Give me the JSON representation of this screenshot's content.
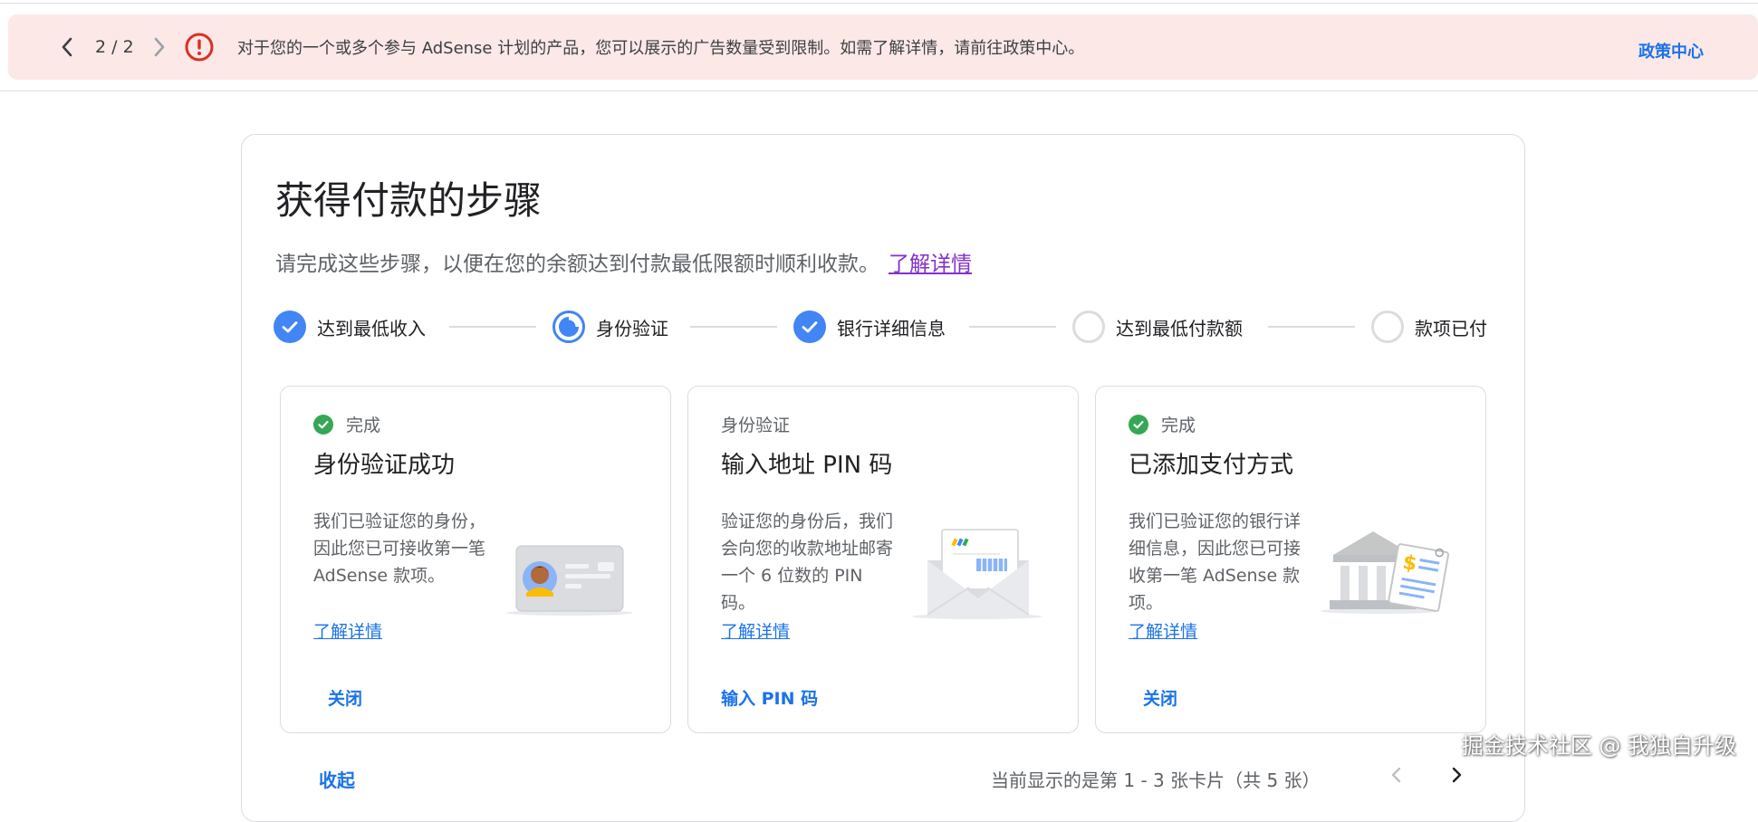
{
  "alert": {
    "pager": "2 / 2",
    "message": "对于您的一个或多个参与 AdSense 计划的产品，您可以展示的广告数量受到限制。如需了解详情，请前往政策中心。",
    "policy_link": "政策中心",
    "color": "#d93025",
    "background": "#fce8e6"
  },
  "main": {
    "title": "获得付款的步骤",
    "subtitle": "请完成这些步骤，以便在您的余额达到付款最低限额时顺利收款。",
    "learn_more": "了解详情"
  },
  "steps": [
    {
      "label": "达到最低收入",
      "state": "done"
    },
    {
      "label": "身份验证",
      "state": "in-progress"
    },
    {
      "label": "银行详细信息",
      "state": "done"
    },
    {
      "label": "达到最低付款额",
      "state": "todo"
    },
    {
      "label": "款项已付",
      "state": "todo"
    }
  ],
  "cards": [
    {
      "status": "完成",
      "title": "身份验证成功",
      "body": "我们已验证您的身份，因此您已可接收第一笔 AdSense 款项。",
      "learn_more": "了解详情",
      "action": "关闭",
      "illustration": "id-card-icon"
    },
    {
      "status": "身份验证",
      "title": "输入地址 PIN 码",
      "body": "验证您的身份后，我们会向您的收款地址邮寄一个 6 位数的 PIN 码。",
      "learn_more": "了解详情",
      "action": "输入 PIN 码",
      "illustration": "envelope-icon"
    },
    {
      "status": "完成",
      "title": "已添加支付方式",
      "body": "我们已验证您的银行详细信息，因此您已可接收第一笔 AdSense 款项。",
      "learn_more": "了解详情",
      "action": "关闭",
      "illustration": "bank-icon"
    }
  ],
  "footer": {
    "collapse": "收起",
    "range": "当前显示的是第 1 - 3 张卡片（共 5 张）"
  },
  "watermark": "掘金技术社区 @ 我独自升级",
  "colors": {
    "accent": "#1a73e8",
    "step_blue": "#4285f4",
    "success": "#34a853",
    "link_visited": "#8430ce"
  }
}
